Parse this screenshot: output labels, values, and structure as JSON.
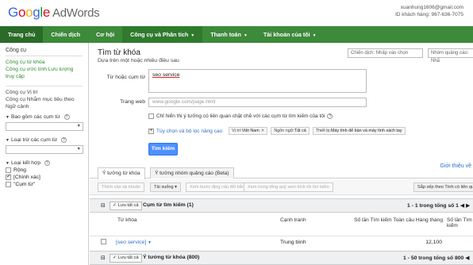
{
  "header": {
    "logo_letters": [
      "G",
      "o",
      "o",
      "g",
      "l",
      "e"
    ],
    "product": "AdWords",
    "account_email": "xuanhung1606@gmail.com",
    "customer_id": "ID khách hàng: 967-636-7075"
  },
  "nav": {
    "tabs": [
      {
        "label": "Trang chủ",
        "active": true,
        "caret": false
      },
      {
        "label": "Chiến dịch",
        "active": false,
        "caret": false
      },
      {
        "label": "Cơ hội",
        "active": false,
        "caret": false
      },
      {
        "label": "Công cụ và Phân tích",
        "active": false,
        "caret": true
      },
      {
        "label": "Thanh toán",
        "active": false,
        "caret": true
      },
      {
        "label": "Tài khoản của tôi",
        "active": false,
        "caret": true
      }
    ]
  },
  "sidebar": {
    "tools_title": "Công cụ",
    "links_group1": [
      "Công cụ từ khóa",
      "Công cụ ước tính Lưu lượng truy cập"
    ],
    "links_group2": [
      "Công cụ Vị trí",
      "Công cụ Nhắm mục tiêu theo Ngữ cảnh"
    ],
    "include_filter": "Bao gồm các cụm từ",
    "exclude_filter": "Loại trừ các cụm từ",
    "match_type_title": "Loại kết hợp",
    "match_types": [
      {
        "label": "Rộng",
        "checked": false
      },
      {
        "label": "[Chính xác]",
        "checked": true
      },
      {
        "label": "\"Cụm từ\"",
        "checked": false
      }
    ]
  },
  "main": {
    "title": "Tìm từ khóa",
    "subtitle": "Dựa trên một hoặc nhiều điều sau",
    "campaign_select": "Chiến dịch: Nhấp vào chọn",
    "adgroup_select": "Nhóm quảng cáo: Nhấ",
    "keyword_label": "Từ hoặc cụm từ",
    "keyword_value": "seo service",
    "website_label": "Trang web",
    "website_placeholder": "www.google.com/page.html",
    "only_closely_related": "Chỉ hiển thị ý tưởng có liên quan chặt chẽ với các cụm từ tìm kiếm của tôi",
    "advanced_link": "Tùy chọn và bộ lọc nâng cao",
    "chips": [
      {
        "key": "Vị trí:",
        "value": "Việt Nam"
      },
      {
        "key": "Ngôn ngữ:",
        "value": "Tất cả"
      },
      {
        "key": "Thiết bị:",
        "value": "Máy tính để bàn và máy tính xách tay"
      }
    ],
    "search_button": "Tìm kiếm",
    "tabs": [
      {
        "label": "Ý tưởng từ khóa",
        "active": true
      },
      {
        "label": "Ý tưởng nhóm quảng cáo (Beta)",
        "active": false
      }
    ],
    "history_link": "Giới thiệu về",
    "toolbar": {
      "add_to_account": "Thêm vào tài khoản",
      "download": "Tải xuống",
      "edit_ad": "Xem bước dịng cấu đổi bắn",
      "view_search": "Xem trong tổng quỹ xem trick tôi tìm kiếm",
      "sort": "Sắp xếp theo Tính có liên quan"
    },
    "group1": {
      "save_all": "Lưu tất cả",
      "title": "Cụm từ tìm kiếm (1)",
      "range": "1 - 1 trong tổng số 1"
    },
    "columns": {
      "keyword": "Từ khóa",
      "competition": "Cạnh tranh",
      "global_searches": "Số lần Tìm kiếm Toàn cầu Hàng tháng",
      "local_searches": "Số lần Tìm kiếm"
    },
    "row1": {
      "keyword": "[seo service]",
      "competition": "Trung bình",
      "global": "12,100"
    },
    "group2": {
      "save_all": "Lưu tất cả",
      "title": "Ý tưởng từ khóa (800)",
      "range": "1 - 50 trong tổng số 800"
    }
  }
}
